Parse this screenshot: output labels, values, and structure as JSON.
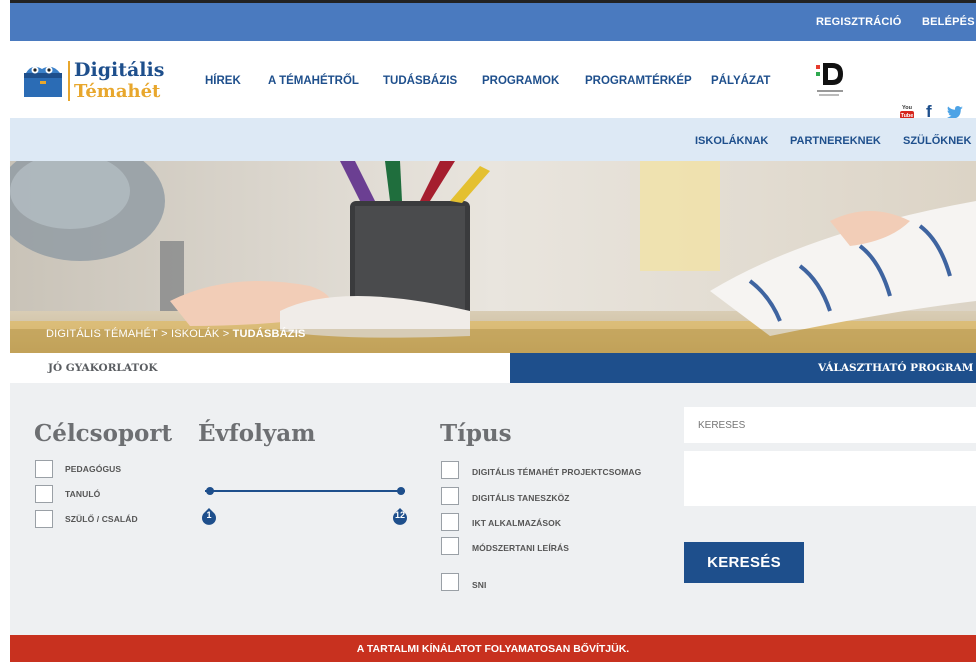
{
  "topbar": {
    "register": "REGISZTRÁCIÓ",
    "login": "BELÉPÉS"
  },
  "logo": {
    "line1": "Digitális",
    "line2": "Témahét"
  },
  "nav": [
    "HÍREK",
    "A TÉMAHÉTRŐL",
    "TUDÁSBÁZIS",
    "PROGRAMOK",
    "PROGRAMTÉRKÉP",
    "PÁLYÁZAT"
  ],
  "dlogo": {
    "letter": "D",
    "caption": "digitális jólét program"
  },
  "social": {
    "youtube": "You Tube",
    "facebook": "f",
    "twitter": "twitter-icon"
  },
  "subnav": [
    "ISKOLÁKNAK",
    "PARTNEREKNEK",
    "SZÜLŐKNEK"
  ],
  "breadcrumb": {
    "item1": "DIGITÁLIS TÉMAHÉT",
    "sep": ">",
    "item2": "ISKOLÁK",
    "current": "TUDÁSBÁZIS"
  },
  "tabs": {
    "left": "JÓ GYAKORLATOK",
    "right": "VÁLASZTHATÓ PROGRAM"
  },
  "filters": {
    "celcsoport": {
      "title": "Célcsoport",
      "options": [
        "PEDAGÓGUS",
        "TANULÓ",
        "SZÜLŐ / CSALÁD"
      ]
    },
    "evfolyam": {
      "title": "Évfolyam",
      "min": "1",
      "max": "12"
    },
    "tipus": {
      "title": "Típus",
      "options": [
        "DIGITÁLIS TÉMAHÉT PROJEKTCSOMAG",
        "DIGITÁLIS TANESZKÖZ",
        "IKT ALKALMAZÁSOK",
        "MÓDSZERTANI LEÍRÁS",
        "SNI"
      ]
    }
  },
  "search": {
    "placeholder": "KERESES",
    "button": "KERESÉS"
  },
  "notice": "A TARTALMI KÍNÁLATOT FOLYAMATOSAN BŐVÍTJÜK.",
  "colors": {
    "brand_blue": "#1e4f8c",
    "top_blue": "#4a7abf",
    "accent_orange": "#e8a72d",
    "notice_red": "#c8311f"
  }
}
